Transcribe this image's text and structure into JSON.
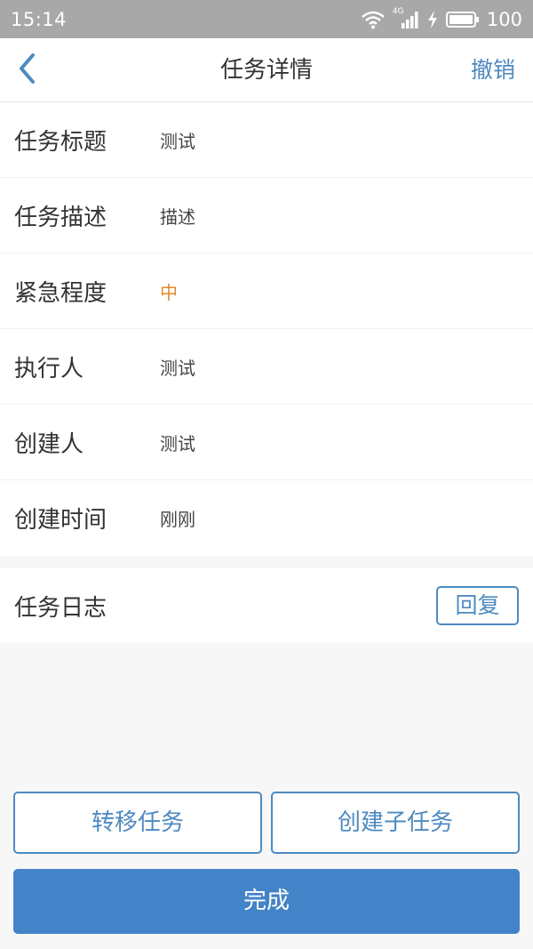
{
  "status_bar": {
    "time": "15:14",
    "network": "4G",
    "battery": "100",
    "icons": [
      "wifi-icon",
      "signal-icon",
      "charging-icon",
      "battery-icon"
    ]
  },
  "nav": {
    "back_icon": "chevron-left-icon",
    "title": "任务详情",
    "action_label": "撤销"
  },
  "details": [
    {
      "label": "任务标题",
      "value": "测试"
    },
    {
      "label": "任务描述",
      "value": "描述"
    },
    {
      "label": "紧急程度",
      "value": "中"
    },
    {
      "label": "执行人",
      "value": "测试"
    },
    {
      "label": "创建人",
      "value": "测试"
    },
    {
      "label": "创建时间",
      "value": "刚刚"
    }
  ],
  "log": {
    "title": "任务日志",
    "reply_label": "回复"
  },
  "actions": {
    "transfer_label": "转移任务",
    "create_subtask_label": "创建子任务",
    "complete_label": "完成"
  },
  "colors": {
    "accent": "#4d8ac0",
    "primary_button": "#4383c7",
    "urgency_medium": "#e4872b",
    "status_bar": "#a8a8a8"
  }
}
